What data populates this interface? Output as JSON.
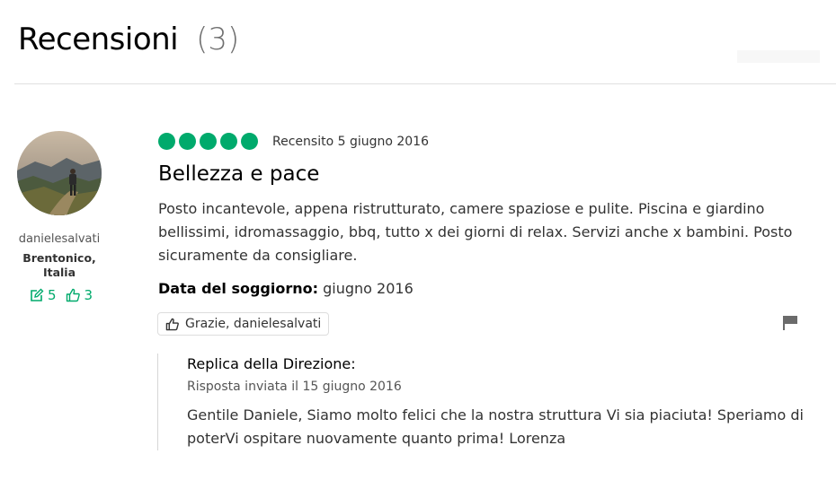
{
  "header": {
    "title": "Recensioni",
    "count": "(3)"
  },
  "user": {
    "name": "danielesalvati",
    "location_line1": "Brentonico,",
    "location_line2": "Italia",
    "contributions": "5",
    "helpful_votes": "3"
  },
  "review": {
    "rating": 5,
    "date": "Recensito 5 giugno 2016",
    "title": "Bellezza e pace",
    "body": "Posto incantevole, appena ristrutturato, camere spaziose e pulite. Piscina e giardino bellissimi, idromassaggio, bbq, tutto x dei giorni di relax. Servizi anche x bambini. Posto sicuramente da consigliare.",
    "stay_label": "Data del soggiorno:",
    "stay_value": "giugno 2016",
    "thanks_label": "Grazie, danielesalvati"
  },
  "reply": {
    "title": "Replica della Direzione:",
    "date": "Risposta inviata il 15 giugno 2016",
    "body": "Gentile Daniele, Siamo molto felici che la nostra struttura Vi sia piaciuta! Speriamo di poterVi ospitare nuovamente quanto prima! Lorenza"
  },
  "colors": {
    "accent": "#00aa6c",
    "text": "#333333",
    "muted": "#707070"
  },
  "icons": {
    "contributions": "pencil-square-icon",
    "helpful": "thumbs-up-icon",
    "report": "flag-icon"
  }
}
